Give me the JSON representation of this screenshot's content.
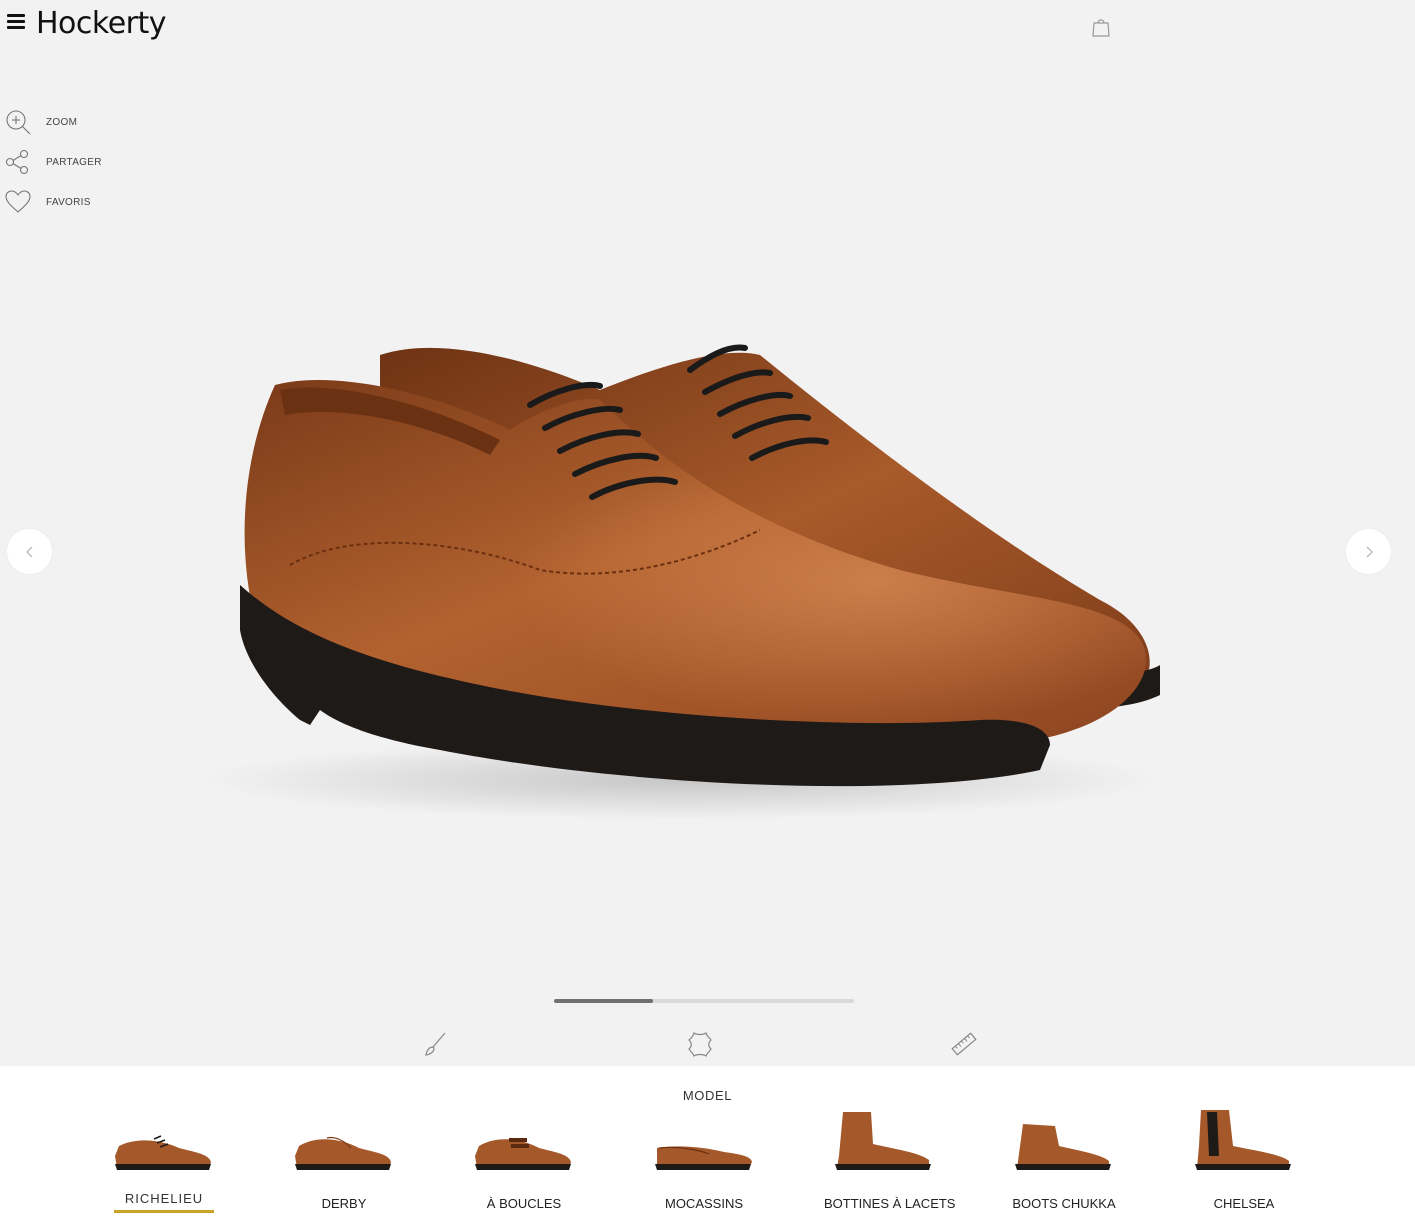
{
  "brand": {
    "name": "Hockerty"
  },
  "tools": [
    {
      "label": "ZOOM",
      "icon": "zoom-in-icon"
    },
    {
      "label": "PARTAGER",
      "icon": "share-icon"
    },
    {
      "label": "FAVORIS",
      "icon": "heart-icon"
    }
  ],
  "gallery": {
    "progress": 0.33
  },
  "config_tabs": [
    "brush-icon",
    "leather-icon",
    "ruler-icon"
  ],
  "model_panel": {
    "title": "MODEL",
    "models": [
      {
        "label": "RICHELIEU",
        "active": true
      },
      {
        "label": "DERBY",
        "active": false
      },
      {
        "label": "À BOUCLES",
        "active": false
      },
      {
        "label": "MOCASSINS",
        "active": false
      },
      {
        "label": "BOTTINES À LACETS",
        "active": false
      },
      {
        "label": "BOOTS CHUKKA",
        "active": false
      },
      {
        "label": "CHELSEA",
        "active": false
      }
    ]
  },
  "colors": {
    "background": "#f3f2f2",
    "leather": "#a5582a",
    "sole": "#1e1a18",
    "accent_underline": "#c9a227"
  }
}
